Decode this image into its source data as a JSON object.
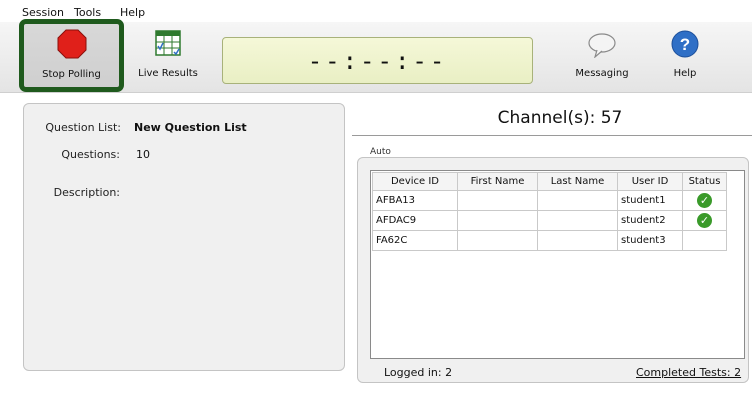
{
  "menu": {
    "session": "Session",
    "tools": "Tools",
    "help": "Help"
  },
  "toolbar": {
    "stop_polling": "Stop Polling",
    "live_results": "Live Results",
    "timer": "--:--:--",
    "messaging": "Messaging",
    "help": "Help"
  },
  "left_panel": {
    "question_list_label": "Question List:",
    "question_list_value": "New Question List",
    "questions_label": "Questions:",
    "questions_value": "10",
    "description_label": "Description:"
  },
  "channel": "Channel(s): 57",
  "mode": "Auto",
  "table": {
    "headers": [
      "Device ID",
      "First Name",
      "Last Name",
      "User ID",
      "Status"
    ],
    "rows": [
      {
        "device_id": "AFBA13",
        "first_name": "",
        "last_name": "",
        "user_id": "student1",
        "status": "completed"
      },
      {
        "device_id": "AFDAC9",
        "first_name": "",
        "last_name": "",
        "user_id": "student2",
        "status": "completed"
      },
      {
        "device_id": "FA62C",
        "first_name": "",
        "last_name": "",
        "user_id": "student3",
        "status": ""
      }
    ]
  },
  "footer": {
    "logged_in": "Logged in:  2",
    "completed_tests": "Completed Tests:  2"
  },
  "colors": {
    "highlight_border": "#1f5a1d",
    "timer_bg": "#f0f4cf",
    "check_green": "#3a9a2a",
    "help_blue": "#2f6fc6",
    "stop_red": "#e0201a"
  }
}
